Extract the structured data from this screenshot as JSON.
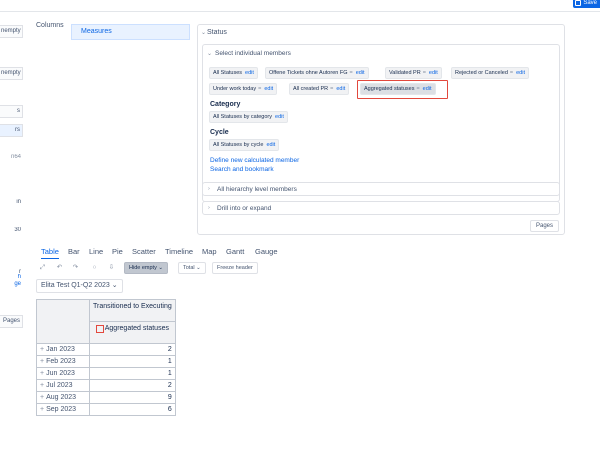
{
  "toolbar": {
    "save_label": "Save"
  },
  "left_panel": {
    "items": [
      "nempty",
      "nempty",
      "s",
      "rs",
      "n64",
      "in",
      "30",
      "r",
      "h",
      "ge",
      "Pages"
    ]
  },
  "columns": {
    "label": "Columns",
    "chip": "Measures"
  },
  "status_panel": {
    "title": "Status",
    "select_individual": "Select individual members",
    "members": [
      {
        "label": "All Statuses",
        "edit": "edit",
        "eq": false
      },
      {
        "label": "Offene Tickets ohne Autoren FG",
        "edit": "edit",
        "eq": true
      },
      {
        "label": "Validated PR",
        "edit": "edit",
        "eq": true
      },
      {
        "label": "Rejected or Canceled",
        "edit": "edit",
        "eq": true
      },
      {
        "label": "Under work today",
        "edit": "edit",
        "eq": true
      },
      {
        "label": "All created PR",
        "edit": "edit",
        "eq": true
      },
      {
        "label": "Aggregated statuses",
        "edit": "edit",
        "eq": true
      }
    ],
    "eq_symbol": "=",
    "category_heading": "Category",
    "category_chip": "All Statuses by category",
    "category_edit": "edit",
    "cycle_heading": "Cycle",
    "cycle_chip": "All Statuses by cycle",
    "cycle_edit": "edit",
    "define_link": "Define new calculated member",
    "search_link": "Search and bookmark",
    "all_hierarchy": "All hierarchy level members",
    "drill_into": "Drill into or expand",
    "pages_button": "Pages"
  },
  "view_tabs": [
    "Table",
    "Bar",
    "Line",
    "Pie",
    "Scatter",
    "Timeline",
    "Map",
    "Gantt",
    "Gauge"
  ],
  "table_toolbar": {
    "icons": [
      "expand-icon",
      "undo-icon",
      "redo-icon",
      "comment-icon",
      "download-icon"
    ],
    "hide_empty": "Hide empty",
    "total": "Total",
    "freeze_header": "Freeze header"
  },
  "page_filter": "Elita Test Q1-Q2 2023",
  "grid": {
    "column_header_1": "Transitioned to Executing",
    "column_header_2": "Aggregated statuses",
    "rows": [
      {
        "label": "Jan 2023",
        "value": "2"
      },
      {
        "label": "Feb 2023",
        "value": "1"
      },
      {
        "label": "Jun 2023",
        "value": "1"
      },
      {
        "label": "Jul 2023",
        "value": "2"
      },
      {
        "label": "Aug 2023",
        "value": "9"
      },
      {
        "label": "Sep 2023",
        "value": "6"
      }
    ]
  }
}
